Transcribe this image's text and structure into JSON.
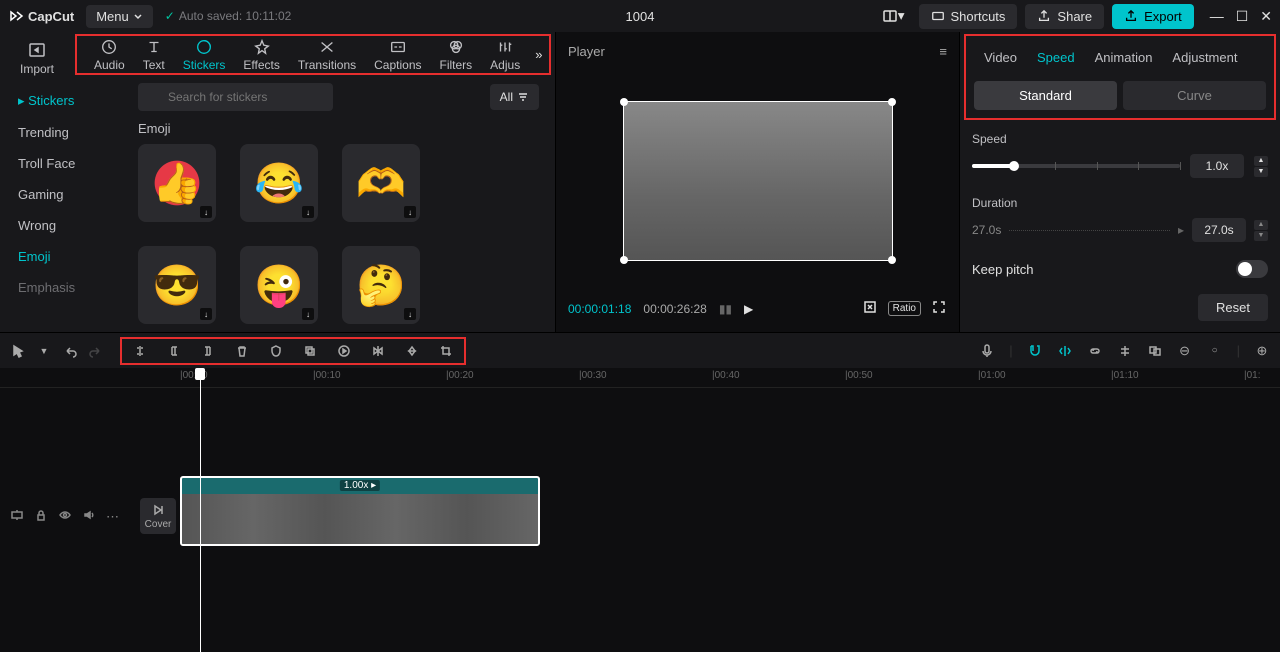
{
  "app": {
    "name": "CapCut",
    "menu": "Menu",
    "autosave": "Auto saved: 10:11:02",
    "title": "1004"
  },
  "titlebar": {
    "shortcuts": "Shortcuts",
    "share": "Share",
    "export": "Export"
  },
  "media_tabs": {
    "import": "Import",
    "items": [
      "Audio",
      "Text",
      "Stickers",
      "Effects",
      "Transitions",
      "Captions",
      "Filters",
      "Adjus"
    ]
  },
  "sidebar": {
    "section": "Stickers",
    "items": [
      "Trending",
      "Troll Face",
      "Gaming",
      "Wrong",
      "Emoji",
      "Emphasis"
    ]
  },
  "content": {
    "search_placeholder": "Search for stickers",
    "filter": "All",
    "section": "Emoji"
  },
  "player": {
    "label": "Player",
    "current": "00:00:01:18",
    "total": "00:00:26:28",
    "ratio": "Ratio"
  },
  "right": {
    "tabs": [
      "Video",
      "Speed",
      "Animation",
      "Adjustment"
    ],
    "subtabs": [
      "Standard",
      "Curve"
    ],
    "speed_label": "Speed",
    "speed_value": "1.0x",
    "duration_label": "Duration",
    "duration_from": "27.0s",
    "duration_to": "27.0s",
    "keep_pitch": "Keep pitch",
    "reset": "Reset"
  },
  "timeline": {
    "marks": [
      "|00:00",
      "|00:10",
      "|00:20",
      "|00:30",
      "|00:40",
      "|00:50",
      "|01:00",
      "|01:10",
      "|01:"
    ],
    "clip_label": "1.00x",
    "cover": "Cover"
  }
}
